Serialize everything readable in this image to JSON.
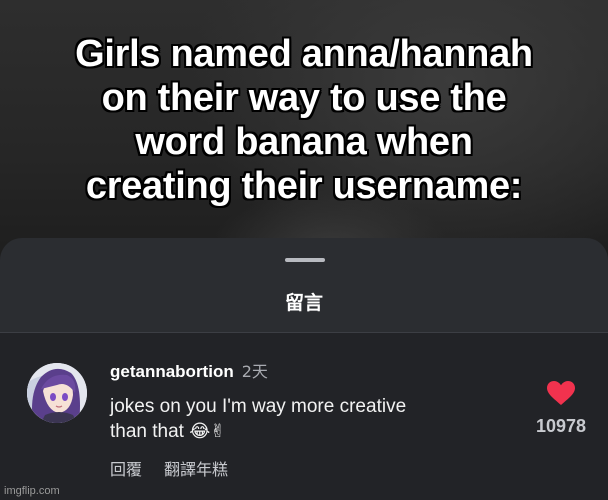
{
  "video": {
    "caption_lines": [
      "Girls named anna/hannah",
      "on their way to use the",
      "word banana when",
      "creating their username:"
    ]
  },
  "comments_panel": {
    "title": "留言",
    "comment": {
      "username": "getannabortion",
      "timestamp": "2天",
      "text_line1": "jokes on you I'm way more creative",
      "text_line2": "than that",
      "emojis": "😂✌",
      "like_count": "10978",
      "reply_label": "回覆",
      "translate_label": "翻譯年糕"
    },
    "colors": {
      "heart": "#f1324e",
      "sheet_bg": "#2b2d31",
      "comment_bg": "#222327"
    }
  },
  "watermark": "imgflip.com",
  "icons": {
    "heart": "heart-icon",
    "avatar": "anime-avatar"
  }
}
